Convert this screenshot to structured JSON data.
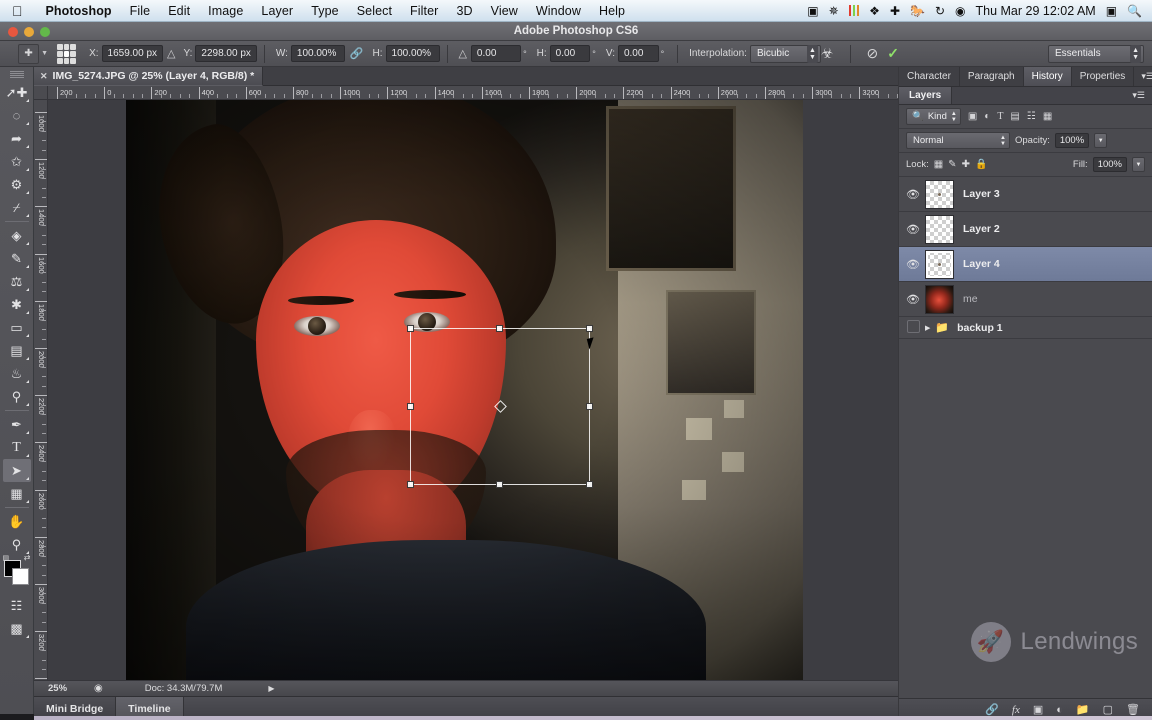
{
  "macbar": {
    "apple": "apple-logo",
    "app_name": "Photoshop",
    "menus": [
      "File",
      "Edit",
      "Image",
      "Layer",
      "Type",
      "Select",
      "Filter",
      "3D",
      "View",
      "Window",
      "Help"
    ],
    "status_icons": [
      "screen-record-icon",
      "bluetooth-icon",
      "equalizer-icon",
      "dropbox-icon",
      "cross-icon",
      "evernote-icon",
      "sync-icon",
      "wifi-icon"
    ],
    "clock": "Thu Mar 29  12:02 AM",
    "battery_icon": "battery-icon",
    "search_icon": "spotlight-search-icon"
  },
  "window": {
    "title": "Adobe Photoshop CS6"
  },
  "options_bar": {
    "tool_icon": "move-tool-icon",
    "reference_point_label": "reference-point-locator",
    "x_label": "X:",
    "x_value": "1659.00 px",
    "y_label": "Y:",
    "y_value": "2298.00 px",
    "w_label": "W:",
    "w_value": "100.00%",
    "link_icon": "link-chain-icon",
    "h_label": "H:",
    "h_value": "100.00%",
    "angle_label": "angle-icon",
    "angle_value": "0.00",
    "degree": "°",
    "skew_h_label": "H:",
    "skew_h_value": "0.00",
    "skew_v_label": "V:",
    "skew_v_value": "0.00",
    "interpolation_label": "Interpolation:",
    "interpolation_value": "Bicubic",
    "warp_icon": "warp-toggle-icon",
    "cancel_icon": "cancel-transform-icon",
    "commit_icon": "commit-transform-icon",
    "workspace_value": "Essentials"
  },
  "toolbar": {
    "tools": [
      {
        "name": "move-tool",
        "glyph": "✛",
        "selected": false
      },
      {
        "name": "marquee-tool",
        "glyph": "⬚",
        "selected": false
      },
      {
        "name": "lasso-tool",
        "glyph": "❀",
        "selected": false
      },
      {
        "name": "quick-selection-tool",
        "glyph": "✐",
        "selected": false
      },
      {
        "name": "crop-tool",
        "glyph": "⌗",
        "selected": false
      },
      {
        "name": "eyedropper-tool",
        "glyph": "✒",
        "selected": false
      },
      {
        "name": "spot-healing-brush-tool",
        "glyph": "⊕",
        "selected": false
      },
      {
        "name": "brush-tool",
        "glyph": "✑",
        "selected": false
      },
      {
        "name": "clone-stamp-tool",
        "glyph": "⚓",
        "selected": false
      },
      {
        "name": "history-brush-tool",
        "glyph": "☙",
        "selected": false
      },
      {
        "name": "eraser-tool",
        "glyph": "▱",
        "selected": false
      },
      {
        "name": "gradient-tool",
        "glyph": "▤",
        "selected": false
      },
      {
        "name": "blur-tool",
        "glyph": "●",
        "selected": false
      },
      {
        "name": "dodge-tool",
        "glyph": "⚲",
        "selected": false
      },
      {
        "name": "pen-tool",
        "glyph": "✒",
        "selected": false
      },
      {
        "name": "type-tool",
        "glyph": "T",
        "selected": false
      },
      {
        "name": "path-selection-tool",
        "glyph": "➤",
        "selected": true
      },
      {
        "name": "rectangle-shape-tool",
        "glyph": "▭",
        "selected": false
      },
      {
        "name": "hand-tool",
        "glyph": "✋",
        "selected": false
      },
      {
        "name": "zoom-tool",
        "glyph": "⚲",
        "selected": false
      }
    ],
    "foreground_color": "#000000",
    "background_color": "#ffffff",
    "quick_mask_icon": "quick-mask-icon",
    "screen_mode_icon": "screen-mode-icon"
  },
  "document": {
    "tab_title": "IMG_5274.JPG @ 25% (Layer 4, RGB/8) *",
    "close_icon": "close-tab-icon",
    "ruler_h_ticks": [
      "200",
      "0",
      "200",
      "400",
      "600",
      "800",
      "1000",
      "1200",
      "1400",
      "1600",
      "1800",
      "2000",
      "2200",
      "2400",
      "2600",
      "2800",
      "3000",
      "3200"
    ],
    "ruler_v_ticks": [
      "1000",
      "1200",
      "1400",
      "1600",
      "1800",
      "2000",
      "2200",
      "2400",
      "2600",
      "2800",
      "3000",
      "3200",
      "3400"
    ],
    "cursor": "arrow-cursor",
    "transform_box": "free-transform-bounding-box"
  },
  "status_bar": {
    "zoom": "25%",
    "preview_icon": "document-preview-icon",
    "doc_info": "Doc: 34.3M/79.7M",
    "expand_icon": "status-expand-arrow"
  },
  "bottom_tabs": [
    {
      "label": "Mini Bridge",
      "active": false
    },
    {
      "label": "Timeline",
      "active": true
    }
  ],
  "panels": {
    "tabs": [
      {
        "label": "Character",
        "active": false
      },
      {
        "label": "Paragraph",
        "active": false
      },
      {
        "label": "History",
        "active": true
      },
      {
        "label": "Properties",
        "active": false
      }
    ],
    "panel_menu_icon": "panel-menu-icon",
    "layers_tab": "Layers",
    "filter": {
      "search_icon": "search-icon",
      "kind_label": "Kind",
      "icons": [
        "pixel-layer-filter-icon",
        "adjustment-layer-filter-icon",
        "type-layer-filter-icon",
        "shape-layer-filter-icon",
        "smart-object-filter-icon",
        "filter-toggle-icon"
      ]
    },
    "blend": {
      "mode": "Normal",
      "opacity_label": "Opacity:",
      "opacity_value": "100%"
    },
    "lock": {
      "label": "Lock:",
      "icons": [
        "lock-transparent-pixels-icon",
        "lock-image-pixels-icon",
        "lock-position-icon",
        "lock-all-icon"
      ],
      "fill_label": "Fill:",
      "fill_value": "100%"
    },
    "layers": [
      {
        "name": "Layer 3",
        "visible": true,
        "selected": false,
        "type": "pixel",
        "has_dot": true
      },
      {
        "name": "Layer 2",
        "visible": true,
        "selected": false,
        "type": "pixel",
        "has_dot": false
      },
      {
        "name": "Layer 4",
        "visible": true,
        "selected": true,
        "type": "pixel",
        "has_dot": true
      },
      {
        "name": "me",
        "visible": true,
        "selected": false,
        "type": "photo",
        "has_dot": false
      },
      {
        "name": "backup 1",
        "visible": false,
        "selected": false,
        "type": "group",
        "has_dot": false
      }
    ],
    "footer_icons": [
      "link-layers-icon",
      "layer-style-fx-icon",
      "add-layer-mask-icon",
      "new-adjustment-layer-icon",
      "new-group-icon",
      "new-layer-icon",
      "delete-layer-icon"
    ]
  },
  "watermark": {
    "icon": "rocket-icon",
    "text": "Lendwings"
  },
  "colors": {
    "ps_chrome": "#4e4e53",
    "panel_bg": "#4a4a4f",
    "selected_layer": "#6e7a98",
    "commit_green": "#8fe06a"
  }
}
